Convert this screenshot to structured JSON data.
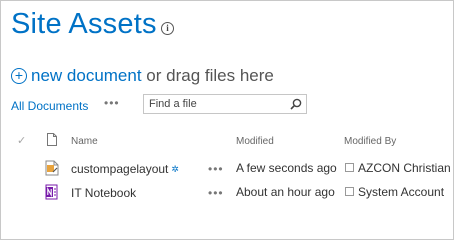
{
  "header": {
    "title": "Site Assets",
    "info_glyph": "i"
  },
  "commands": {
    "plus_glyph": "+",
    "new_document_label": "new document",
    "drag_text": " or drag files here"
  },
  "view": {
    "name": "All Documents",
    "menu_glyph": "•••"
  },
  "search": {
    "placeholder": "Find a file",
    "value": ""
  },
  "columns": {
    "check": "✓",
    "name": "Name",
    "modified": "Modified",
    "modified_by": "Modified By"
  },
  "rows": [
    {
      "name": "custompagelayout",
      "icon": "aspx-file-icon",
      "new_badge": "✲",
      "menu_glyph": "•••",
      "modified": "A few seconds ago",
      "modified_by": "AZCON Christian T"
    },
    {
      "name": "IT Notebook",
      "icon": "onenote-file-icon",
      "menu_glyph": "•••",
      "modified": "About an hour ago",
      "modified_by": "System Account"
    }
  ],
  "colors": {
    "accent": "#0072c6",
    "onenote": "#7719aa",
    "aspx_orange": "#e8a33d"
  }
}
